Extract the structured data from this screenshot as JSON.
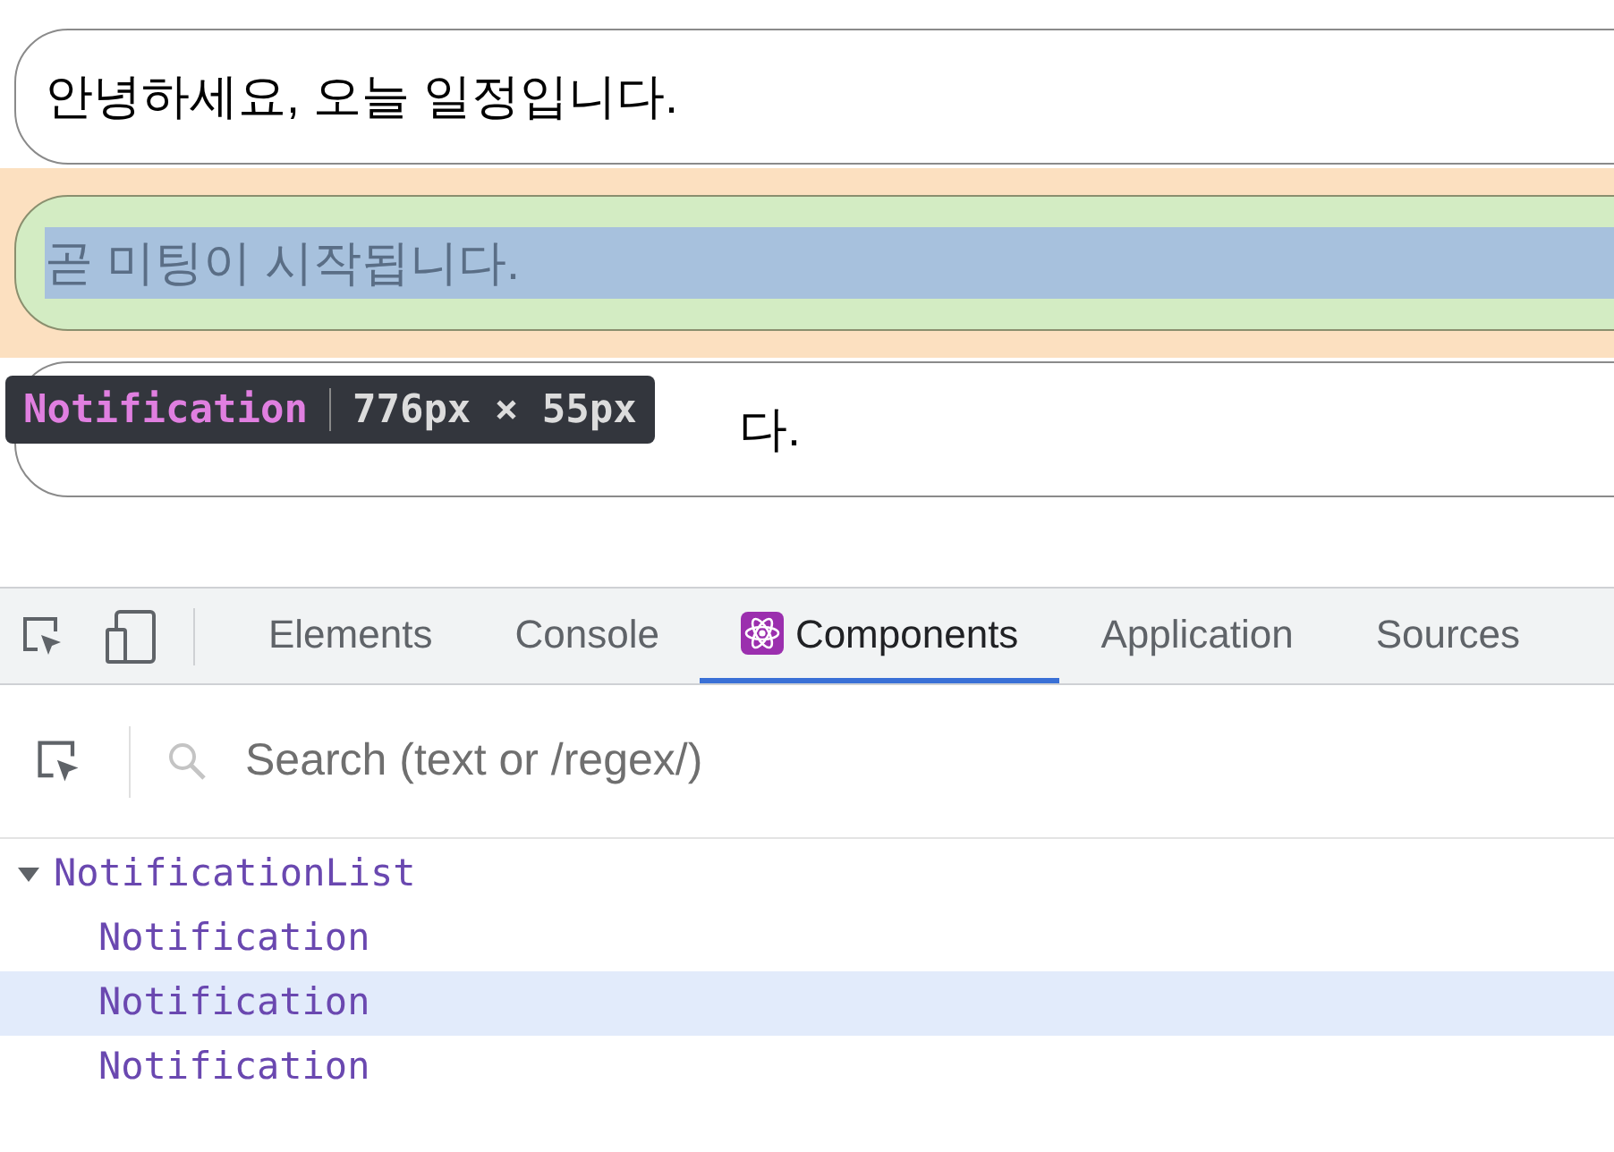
{
  "notifications": [
    {
      "text": "안녕하세요, 오늘 일정입니다.",
      "highlighted": false
    },
    {
      "text": "곧 미팅이 시작됩니다.",
      "highlighted": true
    },
    {
      "text": "다.",
      "highlighted": false
    }
  ],
  "tooltip": {
    "component": "Notification",
    "size": "776px × 55px"
  },
  "devtools": {
    "tabs": [
      {
        "label": "Elements",
        "selected": false,
        "kind": "plain"
      },
      {
        "label": "Console",
        "selected": false,
        "kind": "plain"
      },
      {
        "label": "Components",
        "selected": true,
        "kind": "react"
      },
      {
        "label": "Application",
        "selected": false,
        "kind": "plain"
      },
      {
        "label": "Sources",
        "selected": false,
        "kind": "plain"
      }
    ],
    "search": {
      "placeholder": "Search (text or /regex/)"
    },
    "tree": [
      {
        "label": "NotificationList",
        "expanded": true,
        "selected": false,
        "children": [
          {
            "label": "Notification",
            "selected": false
          },
          {
            "label": "Notification",
            "selected": true
          },
          {
            "label": "Notification",
            "selected": false
          }
        ]
      }
    ]
  }
}
